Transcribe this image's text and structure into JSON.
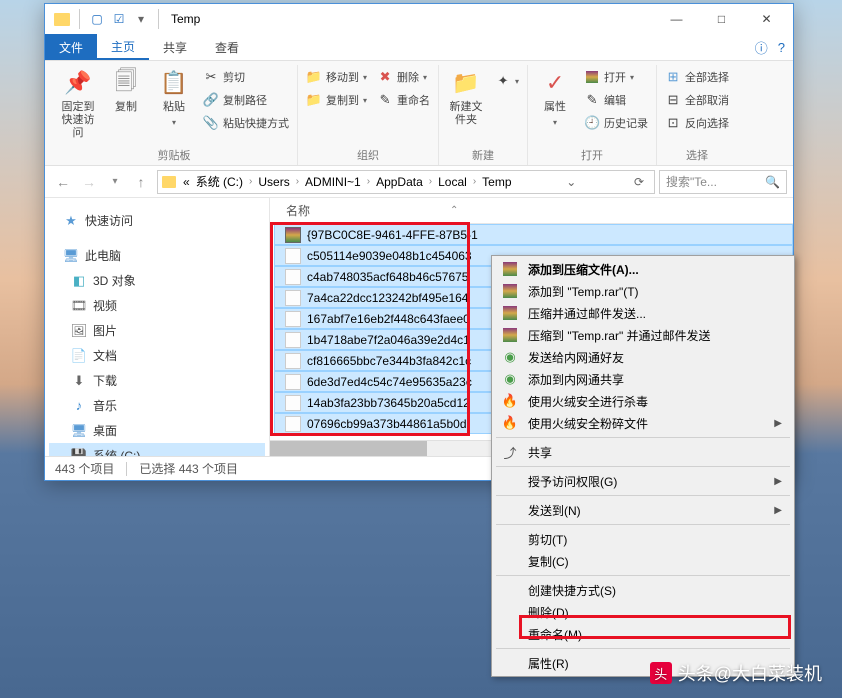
{
  "window": {
    "title": "Temp",
    "controls": {
      "min": "—",
      "max": "□",
      "close": "✕"
    }
  },
  "tabs": {
    "file": "文件",
    "home": "主页",
    "share": "共享",
    "view": "查看"
  },
  "ribbon": {
    "clipboard": {
      "pin": "固定到快速访问",
      "copy": "复制",
      "paste": "粘贴",
      "cut": "剪切",
      "copypath": "复制路径",
      "paste_shortcut": "粘贴快捷方式",
      "group": "剪贴板"
    },
    "organize": {
      "moveto": "移动到",
      "copyto": "复制到",
      "delete": "删除",
      "rename": "重命名",
      "group": "组织"
    },
    "new": {
      "newfolder": "新建文件夹",
      "group": "新建"
    },
    "open": {
      "props": "属性",
      "open": "打开",
      "edit": "编辑",
      "history": "历史记录",
      "group": "打开"
    },
    "select": {
      "selectall": "全部选择",
      "selectnone": "全部取消",
      "invert": "反向选择",
      "group": "选择"
    }
  },
  "breadcrumb": {
    "segments": [
      "系统 (C:)",
      "Users",
      "ADMINI~1",
      "AppData",
      "Local",
      "Temp"
    ],
    "prefix": "«"
  },
  "search": {
    "placeholder": "搜索\"Te..."
  },
  "navpane": {
    "quick": "快速访问",
    "thispc": "此电脑",
    "items": [
      "3D 对象",
      "视频",
      "图片",
      "文档",
      "下载",
      "音乐",
      "桌面",
      "系统 (C:)"
    ]
  },
  "filelist": {
    "header": "名称",
    "rows": [
      {
        "type": "rar",
        "name": "{97BC0C8E-9461-4FFE-87B5-1"
      },
      {
        "type": "txt",
        "name": "c505114e9039e048b1c454063"
      },
      {
        "type": "txt",
        "name": "c4ab748035acf648b46c57675"
      },
      {
        "type": "txt",
        "name": "7a4ca22dcc123242bf495e164"
      },
      {
        "type": "txt",
        "name": "167abf7e16eb2f448c643faee0"
      },
      {
        "type": "txt",
        "name": "1b4718abe7f2a046a39e2d4c1"
      },
      {
        "type": "txt",
        "name": "cf816665bbc7e344b3fa842c1c"
      },
      {
        "type": "txt",
        "name": "6de3d7ed4c54c74e95635a23c"
      },
      {
        "type": "txt",
        "name": "14ab3fa23bb73645b20a5cd12"
      },
      {
        "type": "txt",
        "name": "07696cb99a373b44861a5b0d"
      }
    ]
  },
  "status": {
    "count": "443 个项目",
    "selected": "已选择 443 个项目"
  },
  "context": {
    "add_archive": "添加到压缩文件(A)...",
    "add_temp": "添加到 \"Temp.rar\"(T)",
    "compress_email": "压缩并通过邮件发送...",
    "compress_temp_email": "压缩到 \"Temp.rar\" 并通过邮件发送",
    "send_neitong": "发送给内网通好友",
    "add_neitong": "添加到内网通共享",
    "huorong_scan": "使用火绒安全进行杀毒",
    "huorong_shred": "使用火绒安全粉碎文件",
    "share": "共享",
    "grant_access": "授予访问权限(G)",
    "sendto": "发送到(N)",
    "cut": "剪切(T)",
    "copy": "复制(C)",
    "shortcut": "创建快捷方式(S)",
    "delete": "删除(D)",
    "rename": "重命名(M)",
    "properties": "属性(R)"
  },
  "watermark": "头条@大白菜装机"
}
